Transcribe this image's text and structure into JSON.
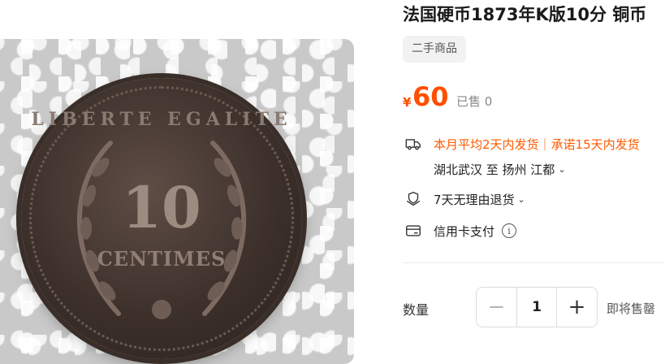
{
  "product": {
    "title": "法国硬币1873年K版10分 铜币",
    "tag": "二手商品",
    "image": {
      "coin_legend": "LIBERTE EGALITE",
      "coin_value": "10",
      "coin_unit": "CENTIMES"
    }
  },
  "price": {
    "symbol": "¥",
    "value": "60",
    "sold": "已售 0"
  },
  "shipping": {
    "icon": "truck-icon",
    "text": "本月平均2天内发货｜承诺15天内发货",
    "route": "湖北武汉 至 扬州 江都",
    "accent_color": "#ff5a00"
  },
  "return_policy": {
    "icon": "shield-hand-icon",
    "text": "7天无理由退货"
  },
  "payment": {
    "icon": "credit-card-icon",
    "text": "信用卡支付",
    "info_icon": "info-icon"
  },
  "quantity": {
    "label": "数量",
    "minus": "−",
    "value": "1",
    "plus": "+",
    "note": "即将售罄"
  }
}
